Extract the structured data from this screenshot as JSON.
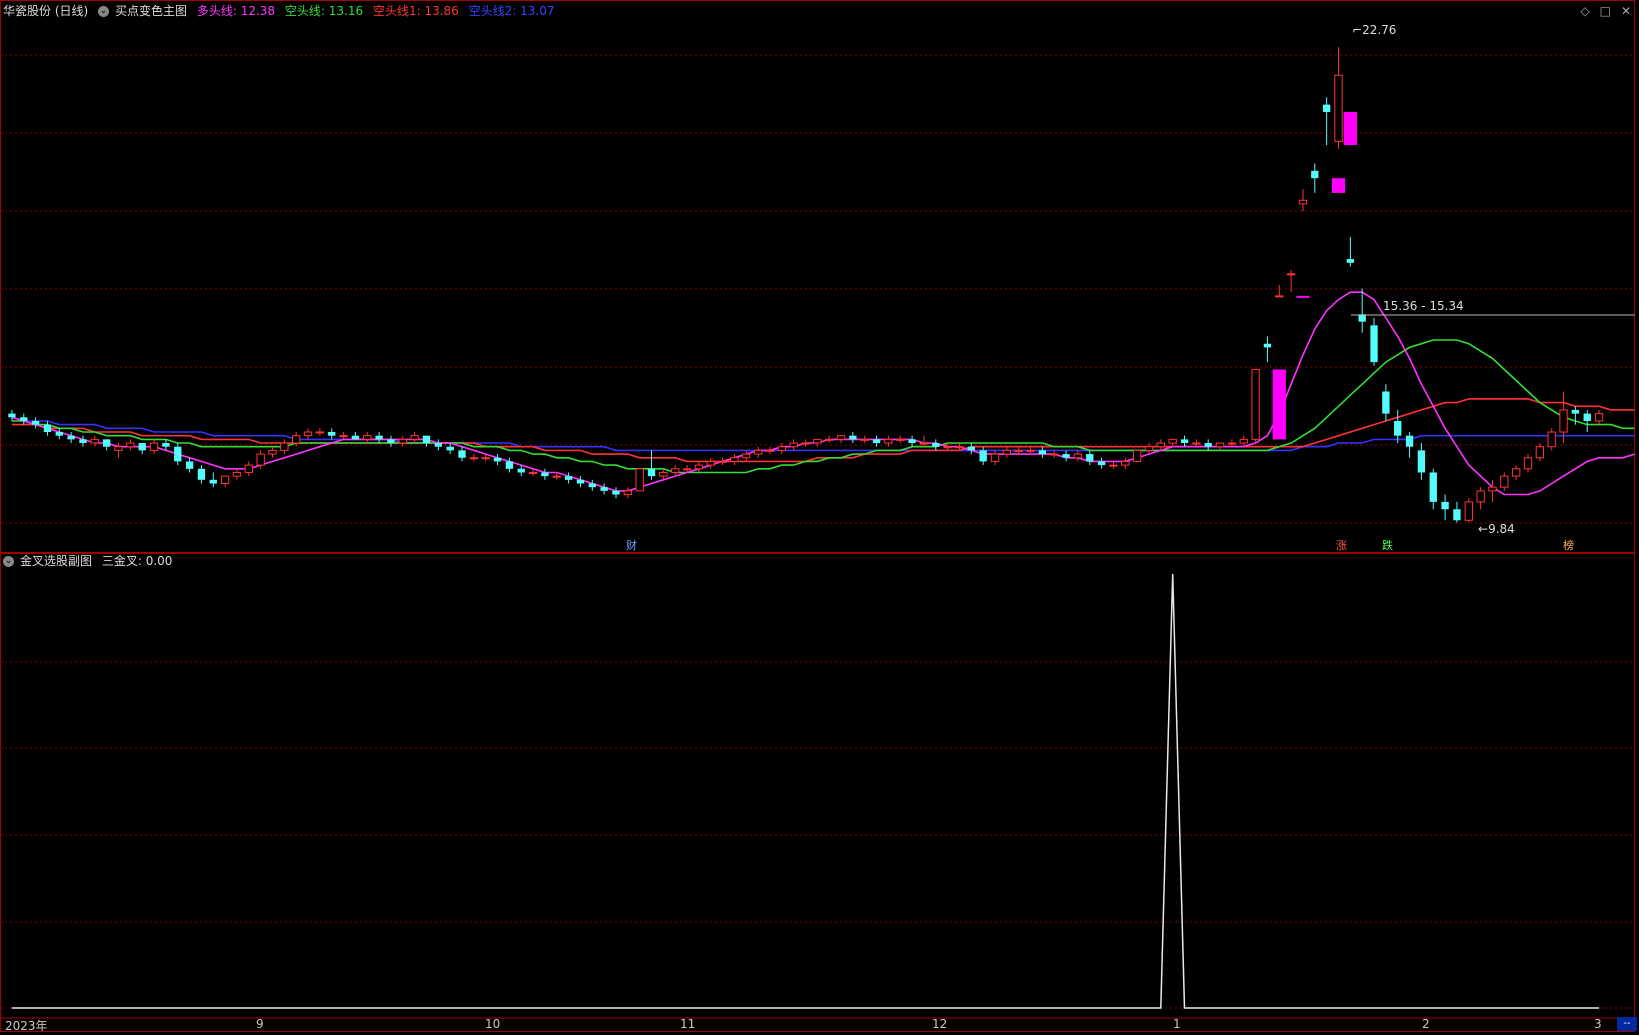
{
  "main_header": {
    "stock": "华瓷股份 (日线)",
    "indicator": "买点变色主图",
    "lines": [
      {
        "text": "多头线: 12.38",
        "color": "#ff33ff"
      },
      {
        "text": "空头线: 13.16",
        "color": "#33dd33"
      },
      {
        "text": "空头线1: 13.86",
        "color": "#ff3333"
      },
      {
        "text": "空头线2: 13.07",
        "color": "#3333ff"
      }
    ]
  },
  "sub_header": {
    "indicator": "金叉选股副图",
    "value_text": "三金叉: 0.00"
  },
  "price_labels": {
    "high": "22.76",
    "low": "9.84",
    "level": "15.36 - 15.34"
  },
  "event_markers": [
    {
      "text": "财",
      "color": "#6fa8ff"
    },
    {
      "text": "涨",
      "color": "#ff5555"
    },
    {
      "text": "跌",
      "color": "#55ff55"
    },
    {
      "text": "榜",
      "color": "#ffb060"
    }
  ],
  "x_axis": [
    "2023年",
    "9",
    "10",
    "11",
    "12",
    "1",
    "2",
    "3"
  ],
  "scroll_label": "--",
  "colors": {
    "up": "#ff3333",
    "down": "#54fcfc",
    "signal": "#ff00ff",
    "grid": "#8b0000",
    "bull_line": "#ff33ff",
    "bear_line": "#33dd33",
    "bear_line1": "#ff3333",
    "bear_line2": "#3333ff"
  },
  "icons": [
    "diamond-icon",
    "expand-icon",
    "close-icon"
  ],
  "chart_data": {
    "type": "candlestick",
    "candles": [
      [
        12.8,
        12.9,
        12.6,
        12.7
      ],
      [
        12.7,
        12.8,
        12.5,
        12.6
      ],
      [
        12.6,
        12.7,
        12.4,
        12.5
      ],
      [
        12.5,
        12.6,
        12.2,
        12.3
      ],
      [
        12.3,
        12.4,
        12.1,
        12.2
      ],
      [
        12.2,
        12.3,
        12.0,
        12.1
      ],
      [
        12.1,
        12.2,
        11.9,
        12.0
      ],
      [
        12.0,
        12.2,
        11.9,
        12.1
      ],
      [
        12.1,
        12.1,
        11.8,
        11.9
      ],
      [
        11.8,
        12.0,
        11.6,
        11.9
      ],
      [
        11.9,
        12.1,
        11.8,
        12.0
      ],
      [
        12.0,
        12.0,
        11.7,
        11.8
      ],
      [
        11.8,
        12.1,
        11.7,
        12.0
      ],
      [
        12.0,
        12.1,
        11.8,
        11.9
      ],
      [
        11.9,
        12.0,
        11.4,
        11.5
      ],
      [
        11.5,
        11.6,
        11.2,
        11.3
      ],
      [
        11.3,
        11.4,
        10.9,
        11.0
      ],
      [
        11.0,
        11.2,
        10.8,
        10.9
      ],
      [
        10.9,
        11.1,
        10.8,
        11.1
      ],
      [
        11.1,
        11.3,
        11.0,
        11.2
      ],
      [
        11.2,
        11.5,
        11.1,
        11.4
      ],
      [
        11.4,
        11.8,
        11.3,
        11.7
      ],
      [
        11.7,
        11.9,
        11.6,
        11.8
      ],
      [
        11.8,
        12.1,
        11.7,
        12.0
      ],
      [
        12.0,
        12.3,
        11.9,
        12.2
      ],
      [
        12.2,
        12.4,
        12.1,
        12.3
      ],
      [
        12.3,
        12.4,
        12.2,
        12.3
      ],
      [
        12.3,
        12.4,
        12.1,
        12.2
      ],
      [
        12.2,
        12.3,
        12.1,
        12.2
      ],
      [
        12.2,
        12.3,
        12.1,
        12.1
      ],
      [
        12.1,
        12.3,
        12.0,
        12.2
      ],
      [
        12.2,
        12.3,
        12.0,
        12.1
      ],
      [
        12.1,
        12.2,
        11.9,
        12.0
      ],
      [
        12.0,
        12.2,
        11.9,
        12.1
      ],
      [
        12.1,
        12.3,
        12.0,
        12.2
      ],
      [
        12.2,
        12.2,
        11.9,
        12.0
      ],
      [
        12.0,
        12.1,
        11.8,
        11.9
      ],
      [
        11.9,
        12.0,
        11.7,
        11.8
      ],
      [
        11.8,
        11.9,
        11.5,
        11.6
      ],
      [
        11.6,
        11.7,
        11.5,
        11.6
      ],
      [
        11.6,
        11.7,
        11.5,
        11.6
      ],
      [
        11.6,
        11.7,
        11.4,
        11.5
      ],
      [
        11.5,
        11.6,
        11.2,
        11.3
      ],
      [
        11.3,
        11.4,
        11.1,
        11.2
      ],
      [
        11.2,
        11.3,
        11.1,
        11.2
      ],
      [
        11.2,
        11.3,
        11.0,
        11.1
      ],
      [
        11.1,
        11.2,
        11.0,
        11.1
      ],
      [
        11.1,
        11.2,
        10.9,
        11.0
      ],
      [
        11.0,
        11.1,
        10.8,
        10.9
      ],
      [
        10.9,
        11.0,
        10.7,
        10.8
      ],
      [
        10.8,
        10.9,
        10.6,
        10.7
      ],
      [
        10.7,
        10.8,
        10.5,
        10.6
      ],
      [
        10.6,
        10.8,
        10.5,
        10.7
      ],
      [
        10.7,
        11.3,
        10.7,
        11.3
      ],
      [
        11.3,
        11.8,
        11.0,
        11.1
      ],
      [
        11.1,
        11.3,
        11.0,
        11.2
      ],
      [
        11.2,
        11.4,
        11.1,
        11.3
      ],
      [
        11.3,
        11.4,
        11.2,
        11.3
      ],
      [
        11.3,
        11.5,
        11.2,
        11.4
      ],
      [
        11.4,
        11.6,
        11.3,
        11.5
      ],
      [
        11.5,
        11.6,
        11.4,
        11.5
      ],
      [
        11.5,
        11.7,
        11.4,
        11.6
      ],
      [
        11.6,
        11.8,
        11.5,
        11.7
      ],
      [
        11.7,
        11.9,
        11.6,
        11.8
      ],
      [
        11.8,
        11.9,
        11.7,
        11.8
      ],
      [
        11.8,
        12.0,
        11.7,
        11.9
      ],
      [
        11.9,
        12.1,
        11.8,
        12.0
      ],
      [
        12.0,
        12.1,
        11.9,
        12.0
      ],
      [
        12.0,
        12.1,
        11.9,
        12.1
      ],
      [
        12.1,
        12.2,
        12.0,
        12.1
      ],
      [
        12.1,
        12.2,
        12.0,
        12.2
      ],
      [
        12.2,
        12.3,
        12.0,
        12.1
      ],
      [
        12.1,
        12.2,
        12.0,
        12.1
      ],
      [
        12.1,
        12.2,
        11.9,
        12.0
      ],
      [
        12.0,
        12.2,
        11.9,
        12.1
      ],
      [
        12.1,
        12.2,
        12.0,
        12.1
      ],
      [
        12.1,
        12.2,
        11.9,
        12.0
      ],
      [
        12.0,
        12.2,
        11.9,
        12.0
      ],
      [
        12.0,
        12.1,
        11.8,
        11.9
      ],
      [
        11.9,
        12.0,
        11.8,
        11.9
      ],
      [
        11.9,
        12.0,
        11.8,
        11.9
      ],
      [
        11.9,
        12.0,
        11.7,
        11.8
      ],
      [
        11.8,
        11.9,
        11.4,
        11.5
      ],
      [
        11.5,
        11.8,
        11.4,
        11.7
      ],
      [
        11.7,
        11.9,
        11.6,
        11.8
      ],
      [
        11.8,
        11.9,
        11.7,
        11.8
      ],
      [
        11.8,
        11.9,
        11.7,
        11.8
      ],
      [
        11.8,
        11.9,
        11.6,
        11.7
      ],
      [
        11.7,
        11.8,
        11.6,
        11.7
      ],
      [
        11.7,
        11.8,
        11.5,
        11.6
      ],
      [
        11.6,
        11.8,
        11.5,
        11.7
      ],
      [
        11.7,
        11.8,
        11.4,
        11.5
      ],
      [
        11.5,
        11.6,
        11.3,
        11.4
      ],
      [
        11.4,
        11.5,
        11.3,
        11.4
      ],
      [
        11.4,
        11.6,
        11.3,
        11.5
      ],
      [
        11.5,
        11.8,
        11.5,
        11.8
      ],
      [
        11.8,
        12.0,
        11.7,
        11.9
      ],
      [
        11.9,
        12.1,
        11.8,
        12.0
      ],
      [
        12.0,
        12.1,
        11.9,
        12.1
      ],
      [
        12.1,
        12.2,
        11.9,
        12.0
      ],
      [
        12.0,
        12.1,
        11.9,
        12.0
      ],
      [
        12.0,
        12.1,
        11.8,
        11.9
      ],
      [
        11.9,
        12.0,
        11.8,
        12.0
      ],
      [
        12.0,
        12.1,
        11.9,
        12.0
      ],
      [
        12.0,
        12.2,
        11.9,
        12.1
      ],
      [
        12.1,
        14.0,
        12.0,
        14.0
      ],
      [
        14.7,
        14.9,
        14.2,
        14.6
      ],
      [
        16.0,
        16.3,
        16.0,
        16.0
      ],
      [
        16.6,
        16.7,
        16.1,
        16.6
      ],
      [
        18.5,
        18.9,
        18.3,
        18.6
      ],
      [
        19.4,
        19.6,
        18.8,
        19.2
      ],
      [
        21.2,
        21.4,
        20.1,
        21.0
      ],
      [
        20.2,
        22.76,
        20.0,
        22.0
      ],
      [
        17.0,
        17.6,
        16.8,
        16.9
      ],
      [
        15.5,
        16.2,
        15.0,
        15.3
      ],
      [
        15.2,
        15.4,
        14.1,
        14.2
      ],
      [
        13.4,
        13.6,
        12.6,
        12.8
      ],
      [
        12.6,
        12.9,
        12.0,
        12.2
      ],
      [
        12.2,
        12.3,
        11.6,
        11.9
      ],
      [
        11.8,
        12.0,
        11.0,
        11.2
      ],
      [
        11.2,
        11.3,
        10.2,
        10.4
      ],
      [
        10.4,
        10.6,
        9.9,
        10.2
      ],
      [
        10.2,
        10.4,
        9.84,
        9.9
      ],
      [
        9.9,
        10.5,
        9.84,
        10.4
      ],
      [
        10.4,
        10.8,
        10.2,
        10.7
      ],
      [
        10.7,
        11.0,
        10.4,
        10.8
      ],
      [
        10.8,
        11.2,
        10.7,
        11.1
      ],
      [
        11.1,
        11.4,
        11.0,
        11.3
      ],
      [
        11.3,
        11.7,
        11.2,
        11.6
      ],
      [
        11.6,
        12.0,
        11.5,
        11.9
      ],
      [
        11.9,
        12.4,
        11.8,
        12.3
      ],
      [
        12.3,
        13.4,
        12.0,
        12.9
      ],
      [
        12.9,
        13.0,
        12.5,
        12.8
      ],
      [
        12.8,
        12.9,
        12.3,
        12.6
      ],
      [
        12.6,
        12.9,
        12.5,
        12.8
      ]
    ],
    "signal_bars": [
      {
        "index": 107,
        "high": 14.0,
        "low": 12.1
      },
      {
        "index": 109,
        "high": 16.0,
        "low": 16.0
      },
      {
        "index": 112,
        "high": 19.2,
        "low": 18.8
      },
      {
        "index": 113,
        "high": 21.0,
        "low": 20.1
      }
    ],
    "lines": {
      "bull": [
        12.7,
        12.6,
        12.5,
        12.4,
        12.3,
        12.2,
        12.1,
        12.0,
        12.0,
        11.9,
        11.9,
        11.9,
        11.9,
        11.8,
        11.7,
        11.6,
        11.5,
        11.4,
        11.3,
        11.3,
        11.3,
        11.4,
        11.5,
        11.6,
        11.7,
        11.8,
        11.9,
        12.0,
        12.1,
        12.1,
        12.1,
        12.1,
        12.1,
        12.1,
        12.1,
        12.1,
        12.0,
        12.0,
        11.9,
        11.8,
        11.7,
        11.6,
        11.5,
        11.4,
        11.3,
        11.2,
        11.2,
        11.1,
        11.0,
        10.9,
        10.8,
        10.7,
        10.7,
        10.8,
        10.9,
        11.0,
        11.1,
        11.2,
        11.3,
        11.4,
        11.5,
        11.6,
        11.7,
        11.8,
        11.8,
        11.9,
        11.9,
        12.0,
        12.0,
        12.1,
        12.1,
        12.1,
        12.1,
        12.1,
        12.1,
        12.1,
        12.1,
        12.0,
        12.0,
        11.9,
        11.9,
        11.8,
        11.7,
        11.7,
        11.7,
        11.7,
        11.7,
        11.7,
        11.7,
        11.6,
        11.6,
        11.5,
        11.5,
        11.5,
        11.5,
        11.6,
        11.7,
        11.8,
        11.9,
        11.9,
        11.9,
        11.9,
        11.9,
        11.9,
        11.9,
        12.0,
        12.2,
        12.8,
        13.6,
        14.4,
        15.1,
        15.6,
        15.9,
        16.1,
        16.1,
        15.9,
        15.4,
        14.9,
        14.3,
        13.6,
        13.0,
        12.4,
        11.9,
        11.4,
        11.1,
        10.8,
        10.6,
        10.6,
        10.6,
        10.7,
        10.9,
        11.1,
        11.3,
        11.5,
        11.6,
        11.6,
        11.6,
        11.7
      ],
      "bear": [
        12.6,
        12.6,
        12.5,
        12.5,
        12.4,
        12.4,
        12.3,
        12.3,
        12.2,
        12.2,
        12.2,
        12.1,
        12.1,
        12.1,
        12.0,
        12.0,
        11.9,
        11.9,
        11.9,
        11.9,
        11.9,
        11.9,
        11.9,
        11.9,
        12.0,
        12.0,
        12.0,
        12.0,
        12.0,
        12.0,
        12.0,
        12.0,
        12.0,
        12.0,
        12.0,
        12.0,
        12.0,
        12.0,
        12.0,
        11.9,
        11.9,
        11.9,
        11.8,
        11.8,
        11.7,
        11.7,
        11.6,
        11.6,
        11.5,
        11.5,
        11.4,
        11.4,
        11.3,
        11.3,
        11.3,
        11.3,
        11.2,
        11.2,
        11.2,
        11.2,
        11.2,
        11.2,
        11.2,
        11.3,
        11.3,
        11.4,
        11.4,
        11.5,
        11.5,
        11.6,
        11.6,
        11.7,
        11.7,
        11.8,
        11.8,
        11.8,
        11.9,
        11.9,
        11.9,
        12.0,
        12.0,
        12.0,
        12.0,
        12.0,
        12.0,
        12.0,
        12.0,
        12.0,
        11.9,
        11.9,
        11.9,
        11.8,
        11.8,
        11.8,
        11.8,
        11.8,
        11.8,
        11.8,
        11.8,
        11.8,
        11.8,
        11.8,
        11.8,
        11.8,
        11.8,
        11.8,
        11.8,
        11.9,
        12.0,
        12.2,
        12.4,
        12.7,
        13.0,
        13.3,
        13.6,
        13.9,
        14.2,
        14.4,
        14.6,
        14.7,
        14.8,
        14.8,
        14.8,
        14.7,
        14.5,
        14.3,
        14.0,
        13.7,
        13.4,
        13.1,
        12.9,
        12.7,
        12.6,
        12.5,
        12.5,
        12.5,
        12.4,
        12.4
      ],
      "bear1": [
        12.5,
        12.5,
        12.5,
        12.4,
        12.4,
        12.4,
        12.4,
        12.3,
        12.3,
        12.3,
        12.3,
        12.2,
        12.2,
        12.2,
        12.2,
        12.2,
        12.1,
        12.1,
        12.1,
        12.1,
        12.1,
        12.0,
        12.0,
        12.0,
        12.0,
        12.0,
        12.0,
        12.0,
        12.0,
        12.0,
        12.0,
        12.0,
        12.0,
        12.0,
        12.0,
        12.0,
        12.0,
        12.0,
        12.0,
        12.0,
        11.9,
        11.9,
        11.9,
        11.9,
        11.9,
        11.8,
        11.8,
        11.8,
        11.8,
        11.7,
        11.7,
        11.7,
        11.7,
        11.6,
        11.6,
        11.6,
        11.6,
        11.5,
        11.5,
        11.5,
        11.5,
        11.5,
        11.5,
        11.5,
        11.5,
        11.5,
        11.5,
        11.5,
        11.6,
        11.6,
        11.6,
        11.6,
        11.7,
        11.7,
        11.7,
        11.7,
        11.8,
        11.8,
        11.8,
        11.8,
        11.8,
        11.9,
        11.9,
        11.9,
        11.9,
        11.9,
        11.9,
        11.9,
        11.9,
        11.9,
        11.9,
        11.9,
        11.9,
        11.9,
        11.9,
        11.9,
        11.9,
        11.9,
        11.9,
        11.9,
        11.9,
        11.9,
        11.9,
        11.9,
        11.9,
        11.9,
        11.9,
        11.9,
        11.9,
        11.9,
        12.0,
        12.1,
        12.2,
        12.3,
        12.4,
        12.5,
        12.6,
        12.7,
        12.8,
        12.9,
        13.0,
        13.1,
        13.1,
        13.2,
        13.2,
        13.2,
        13.2,
        13.2,
        13.2,
        13.1,
        13.1,
        13.1,
        13.0,
        13.0,
        13.0,
        12.9,
        12.9,
        12.9
      ],
      "bear2": [
        12.7,
        12.6,
        12.6,
        12.6,
        12.5,
        12.5,
        12.5,
        12.5,
        12.4,
        12.4,
        12.4,
        12.4,
        12.3,
        12.3,
        12.3,
        12.3,
        12.3,
        12.2,
        12.2,
        12.2,
        12.2,
        12.2,
        12.2,
        12.2,
        12.1,
        12.1,
        12.1,
        12.1,
        12.1,
        12.1,
        12.1,
        12.1,
        12.1,
        12.0,
        12.0,
        12.0,
        12.0,
        12.0,
        12.0,
        12.0,
        12.0,
        12.0,
        12.0,
        11.9,
        11.9,
        11.9,
        11.9,
        11.9,
        11.9,
        11.9,
        11.9,
        11.8,
        11.8,
        11.8,
        11.8,
        11.8,
        11.8,
        11.8,
        11.8,
        11.8,
        11.8,
        11.8,
        11.8,
        11.8,
        11.8,
        11.8,
        11.8,
        11.8,
        11.8,
        11.8,
        11.8,
        11.8,
        11.8,
        11.8,
        11.8,
        11.8,
        11.8,
        11.8,
        11.8,
        11.8,
        11.8,
        11.8,
        11.8,
        11.8,
        11.8,
        11.8,
        11.8,
        11.8,
        11.8,
        11.8,
        11.8,
        11.8,
        11.8,
        11.8,
        11.8,
        11.8,
        11.8,
        11.8,
        11.8,
        11.8,
        11.8,
        11.8,
        11.8,
        11.8,
        11.8,
        11.8,
        11.8,
        11.8,
        11.8,
        11.9,
        11.9,
        11.9,
        12.0,
        12.0,
        12.0,
        12.1,
        12.1,
        12.1,
        12.1,
        12.2,
        12.2,
        12.2,
        12.2,
        12.2,
        12.2,
        12.2,
        12.2,
        12.2,
        12.2,
        12.2,
        12.2,
        12.2,
        12.2,
        12.2,
        12.2,
        12.2,
        12.2,
        12.2
      ]
    },
    "sub_values": {
      "baseline": 0.0,
      "spike_index": 98,
      "spike_value": 1.0
    },
    "ylim": [
      9.5,
      23.5
    ]
  }
}
